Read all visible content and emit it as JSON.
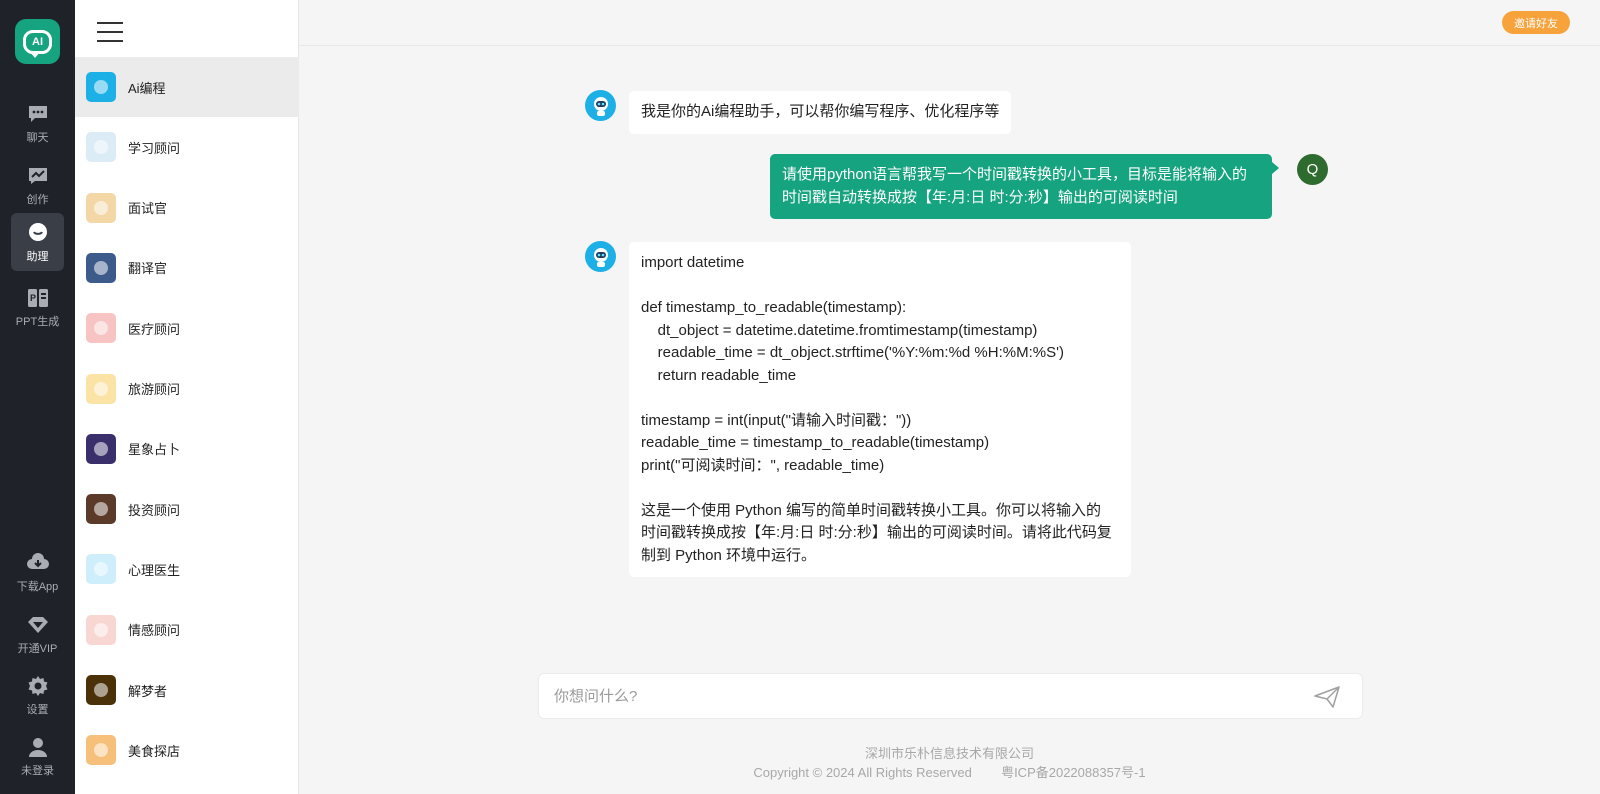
{
  "logo": {
    "text": "AI"
  },
  "rail": {
    "items": [
      {
        "label": "聊天",
        "icon": "chat-icon"
      },
      {
        "label": "创作",
        "icon": "chart-icon"
      },
      {
        "label": "助理",
        "icon": "assistant-icon",
        "active": true
      },
      {
        "label": "PPT生成",
        "icon": "ppt-icon"
      },
      {
        "label": "下载App",
        "icon": "download-icon"
      },
      {
        "label": "开通VIP",
        "icon": "diamond-icon"
      },
      {
        "label": "设置",
        "icon": "gear-icon"
      },
      {
        "label": "未登录",
        "icon": "user-icon"
      }
    ]
  },
  "assistants": [
    {
      "label": "Ai编程",
      "active": true,
      "color": "#1db0e6"
    },
    {
      "label": "学习顾问",
      "color": "#dcecf7"
    },
    {
      "label": "面试官",
      "color": "#f4d7a6"
    },
    {
      "label": "翻译官",
      "color": "#3c5a8a"
    },
    {
      "label": "医疗顾问",
      "color": "#f7c3c3"
    },
    {
      "label": "旅游顾问",
      "color": "#fbe3a6"
    },
    {
      "label": "星象占卜",
      "color": "#3a2f6b"
    },
    {
      "label": "投资顾问",
      "color": "#5c3a2a"
    },
    {
      "label": "心理医生",
      "color": "#cdeefa"
    },
    {
      "label": "情感顾问",
      "color": "#f8d6d2"
    },
    {
      "label": "解梦者",
      "color": "#4a3108"
    },
    {
      "label": "美食探店",
      "color": "#f6c07a"
    }
  ],
  "header": {
    "invite_label": "邀请好友"
  },
  "chat": {
    "greeting": "我是你的Ai编程助手，可以帮你编写程序、优化程序等",
    "user_message": "请使用python语言帮我写一个时间戳转换的小工具，目标是能将输入的时间戳自动转换成按【年:月:日 时:分:秒】输出的可阅读时间",
    "user_avatar": "Q",
    "reply_lines": [
      "import datetime",
      "",
      "def timestamp_to_readable(timestamp):",
      "    dt_object = datetime.datetime.fromtimestamp(timestamp)",
      "    readable_time = dt_object.strftime('%Y:%m:%d %H:%M:%S')",
      "    return readable_time",
      "",
      "timestamp = int(input(\"请输入时间戳：\"))",
      "readable_time = timestamp_to_readable(timestamp)",
      "print(\"可阅读时间：\", readable_time)",
      "",
      "这是一个使用 Python 编写的简单时间戳转换小工具。你可以将输入的",
      "时间戳转换成按【年:月:日 时:分:秒】输出的可阅读时间。请将此代码复",
      "制到 Python 环境中运行。"
    ]
  },
  "input": {
    "placeholder": "你想问什么?"
  },
  "footer": {
    "company": "深圳市乐朴信息技术有限公司",
    "copyright": "Copyright © 2024 All Rights Reserved",
    "icp": "粤ICP备2022088357号-1"
  },
  "colors": {
    "accent": "#16a37f",
    "rail_bg": "#1f2329",
    "invite": "#f7a23b",
    "bot_avatar": "#1db0e6"
  }
}
